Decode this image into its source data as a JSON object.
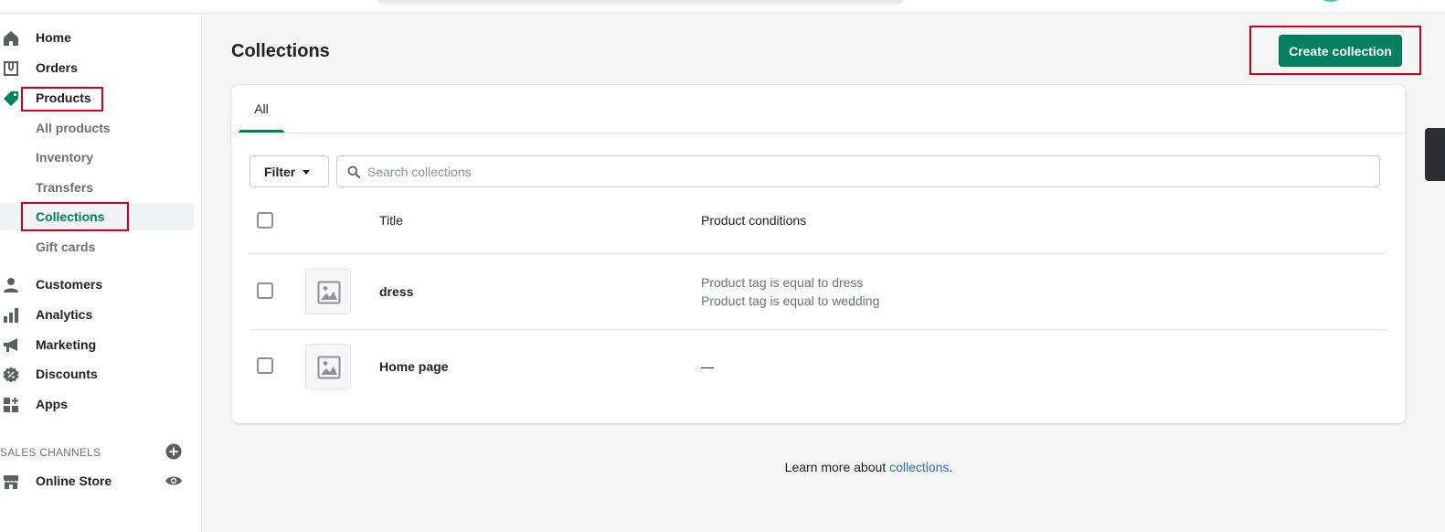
{
  "nav": {
    "items": [
      {
        "label": "Home",
        "icon": "home-icon"
      },
      {
        "label": "Orders",
        "icon": "orders-icon"
      },
      {
        "label": "Products",
        "icon": "tag-icon"
      }
    ],
    "products_sub": [
      "All products",
      "Inventory",
      "Transfers",
      "Collections",
      "Gift cards"
    ],
    "items_after": [
      {
        "label": "Customers",
        "icon": "person-icon"
      },
      {
        "label": "Analytics",
        "icon": "bar-chart-icon"
      },
      {
        "label": "Marketing",
        "icon": "megaphone-icon"
      },
      {
        "label": "Discounts",
        "icon": "discount-badge-icon"
      },
      {
        "label": "Apps",
        "icon": "apps-icon"
      }
    ],
    "sales_channels_label": "SALES CHANNELS",
    "online_store": "Online Store",
    "active_item": "Collections"
  },
  "page": {
    "title": "Collections",
    "create_button": "Create collection"
  },
  "tabs": [
    "All"
  ],
  "filter": {
    "label": "Filter"
  },
  "search": {
    "placeholder": "Search collections",
    "value": ""
  },
  "table": {
    "columns": [
      "Title",
      "Product conditions"
    ],
    "rows": [
      {
        "title": "dress",
        "conditions": [
          "Product tag is equal to dress",
          "Product tag is equal to wedding"
        ]
      },
      {
        "title": "Home page",
        "conditions": [
          "—"
        ]
      }
    ]
  },
  "footer": {
    "prefix": "Learn more about ",
    "link": "collections",
    "suffix": "."
  },
  "colors": {
    "accent": "#008060",
    "highlight": "#d0021b",
    "link": "#2c6ecb"
  }
}
